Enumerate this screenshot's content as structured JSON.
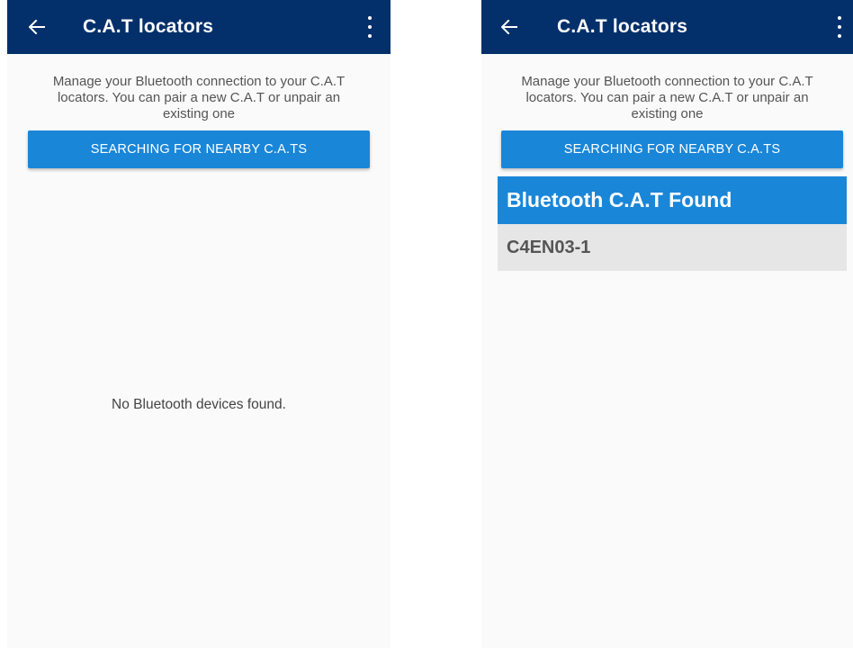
{
  "screens": [
    {
      "title": "C.A.T locators",
      "description": "Manage your Bluetooth connection to your C.A.T locators. You can pair a new C.A.T or unpair an existing one",
      "search_button_label": "SEARCHING FOR NEARBY C.A.TS",
      "empty_message": "No Bluetooth devices found."
    },
    {
      "title": "C.A.T locators",
      "description": "Manage your Bluetooth connection to your C.A.T locators. You can pair a new C.A.T or unpair an existing one",
      "search_button_label": "SEARCHING FOR NEARBY C.A.TS",
      "found_header": "Bluetooth C.A.T Found",
      "devices": [
        "C4EN03-1"
      ]
    }
  ],
  "icons": {
    "back": "arrow-left-icon",
    "menu": "more-vertical-icon"
  },
  "colors": {
    "appbar": "#03306b",
    "accent": "#1a86d8",
    "background": "#fafafa",
    "device_row": "#e6e6e6"
  }
}
